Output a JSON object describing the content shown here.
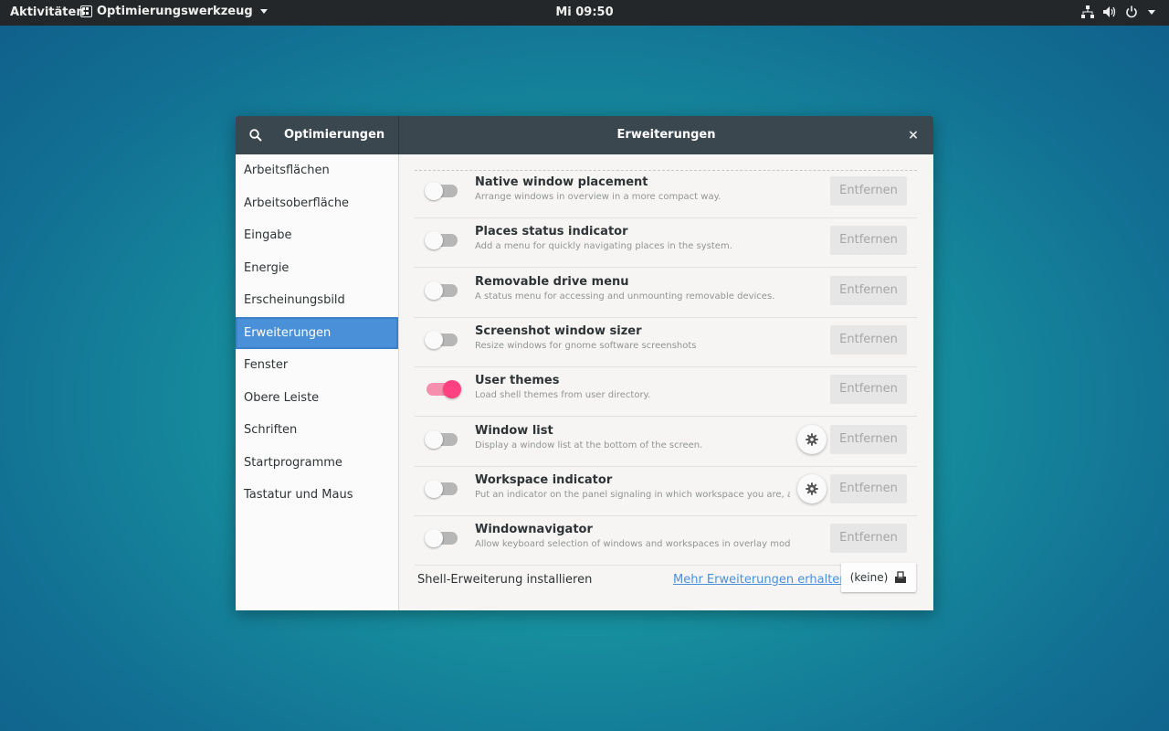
{
  "topbar": {
    "activities": "Aktivitäten",
    "app_name": "Optimierungswerkzeug",
    "clock": "Mi 09:50",
    "tray_icons": [
      "network-icon",
      "volume-icon",
      "power-icon",
      "chevron-down-icon"
    ]
  },
  "window": {
    "sidebar_title": "Optimierungen",
    "main_title": "Erweiterungen",
    "close_glyph": "×"
  },
  "sidebar": {
    "items": [
      {
        "label": "Arbeitsflächen"
      },
      {
        "label": "Arbeitsoberfläche"
      },
      {
        "label": "Eingabe"
      },
      {
        "label": "Energie"
      },
      {
        "label": "Erscheinungsbild"
      },
      {
        "label": "Erweiterungen",
        "selected": true
      },
      {
        "label": "Fenster"
      },
      {
        "label": "Obere Leiste"
      },
      {
        "label": "Schriften"
      },
      {
        "label": "Startprogramme"
      },
      {
        "label": "Tastatur und Maus"
      }
    ]
  },
  "extensions": [
    {
      "name": "Native window placement",
      "description": "Arrange windows in overview in a more compact way.",
      "enabled": false,
      "has_settings": false,
      "remove_label": "Entfernen"
    },
    {
      "name": "Places status indicator",
      "description": "Add a menu for quickly navigating places in the system.",
      "enabled": false,
      "has_settings": false,
      "remove_label": "Entfernen"
    },
    {
      "name": "Removable drive menu",
      "description": "A status menu for accessing and unmounting removable devices.",
      "enabled": false,
      "has_settings": false,
      "remove_label": "Entfernen"
    },
    {
      "name": "Screenshot window sizer",
      "description": "Resize windows for gnome software screenshots",
      "enabled": false,
      "has_settings": false,
      "remove_label": "Entfernen"
    },
    {
      "name": "User themes",
      "description": "Load shell themes from user directory.",
      "enabled": true,
      "has_settings": false,
      "remove_label": "Entfernen"
    },
    {
      "name": "Window list",
      "description": "Display a window list at the bottom of the screen.",
      "enabled": false,
      "has_settings": true,
      "remove_label": "Entfernen"
    },
    {
      "name": "Workspace indicator",
      "description": "Put an indicator on the panel signaling in which workspace you are, an...",
      "enabled": false,
      "has_settings": true,
      "remove_label": "Entfernen"
    },
    {
      "name": "Windownavigator",
      "description": "Allow keyboard selection of windows and workspaces in overlay mode. <ctrl>...",
      "enabled": false,
      "has_settings": false,
      "remove_label": "Entfernen"
    }
  ],
  "footer": {
    "install_label": "Shell-Erweiterung installieren",
    "more_link": "Mehr Erweiterungen erhalten",
    "file_chooser_value": "(keine)"
  },
  "colors": {
    "accent": "#4a90d9",
    "switch_on": "#ff4081",
    "titlebar": "#3b474f"
  }
}
